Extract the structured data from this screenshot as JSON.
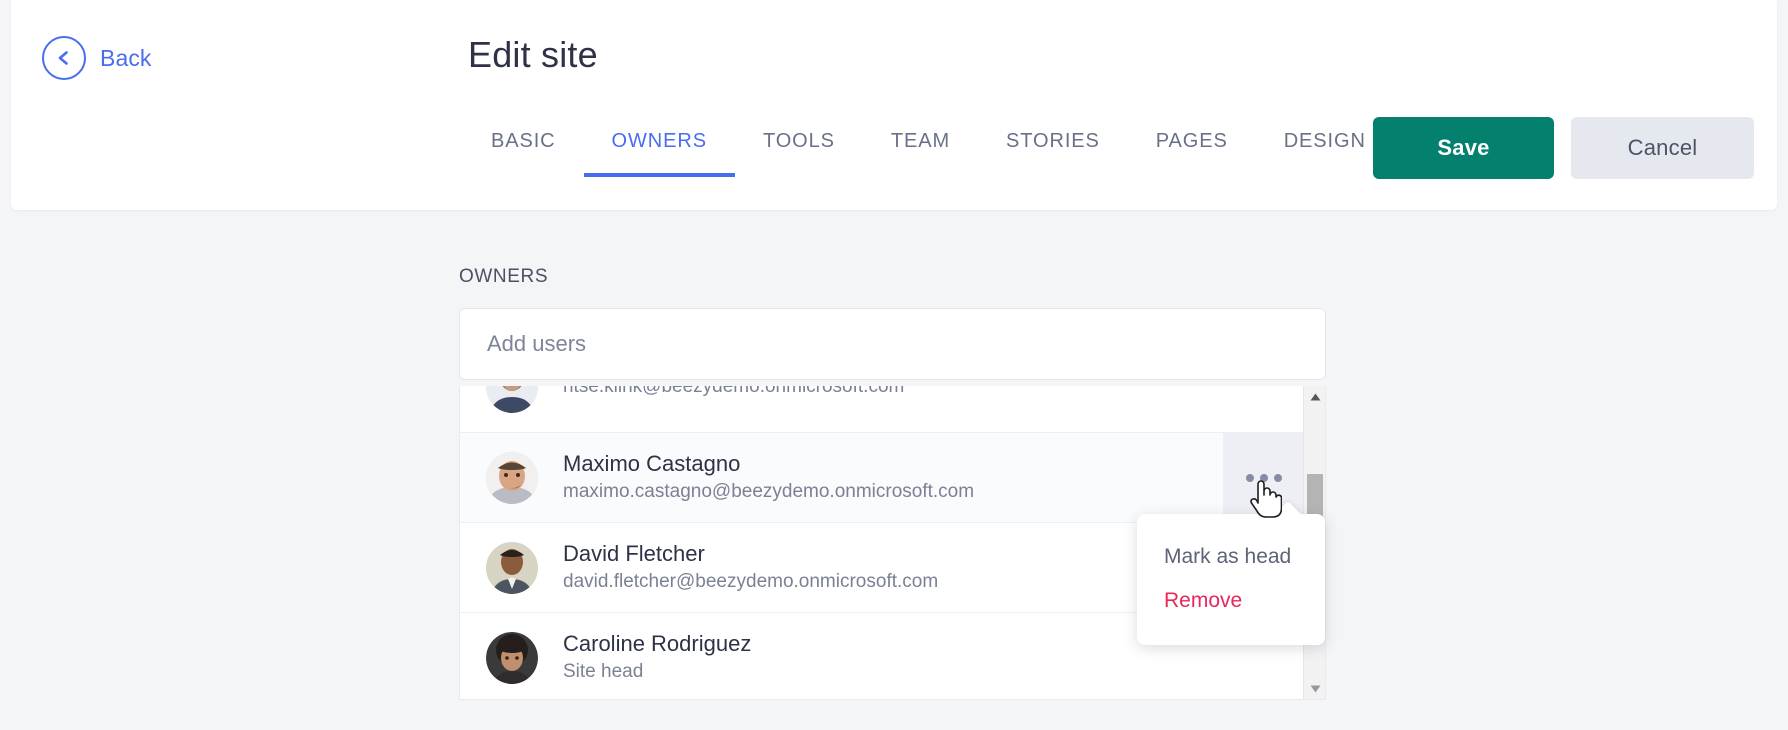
{
  "header": {
    "back_label": "Back",
    "back_icon": "chevron-left-circle-icon",
    "title": "Edit site",
    "tabs": [
      {
        "label": "BASIC",
        "active": false
      },
      {
        "label": "OWNERS",
        "active": true
      },
      {
        "label": "TOOLS",
        "active": false
      },
      {
        "label": "TEAM",
        "active": false
      },
      {
        "label": "STORIES",
        "active": false
      },
      {
        "label": "PAGES",
        "active": false
      },
      {
        "label": "DESIGN",
        "active": false
      }
    ],
    "save_label": "Save",
    "cancel_label": "Cancel"
  },
  "owners_section": {
    "label": "OWNERS",
    "add_users": {
      "placeholder": "Add users",
      "value": ""
    },
    "rows": [
      {
        "name": "",
        "sub": "ritse.klink@beezydemo.onmicrosoft.com",
        "avatar": "avatar-ritse-klink",
        "hovered": false
      },
      {
        "name": "Maximo Castagno",
        "sub": "maximo.castagno@beezydemo.onmicrosoft.com",
        "avatar": "avatar-maximo-castagno",
        "hovered": true
      },
      {
        "name": "David Fletcher",
        "sub": "david.fletcher@beezydemo.onmicrosoft.com",
        "avatar": "avatar-david-fletcher",
        "hovered": false
      },
      {
        "name": "Caroline Rodriguez",
        "sub": "Site head",
        "avatar": "avatar-caroline-rodriguez",
        "hovered": false
      }
    ],
    "kebab_icon": "more-options-icon"
  },
  "context_menu": {
    "items": [
      {
        "label": "Mark as head",
        "danger": false
      },
      {
        "label": "Remove",
        "danger": true
      }
    ]
  },
  "scrollbar": {
    "up_icon": "caret-up-icon",
    "down_icon": "caret-down-icon"
  },
  "cursor": {
    "icon": "pointer-hand-cursor"
  },
  "colors": {
    "accent_blue": "#4a6cf0",
    "save_green": "#04806e",
    "danger_red": "#e8285a",
    "page_bg": "#f4f5f7",
    "text_dark": "#2e3247",
    "text_muted": "#7b8195"
  }
}
